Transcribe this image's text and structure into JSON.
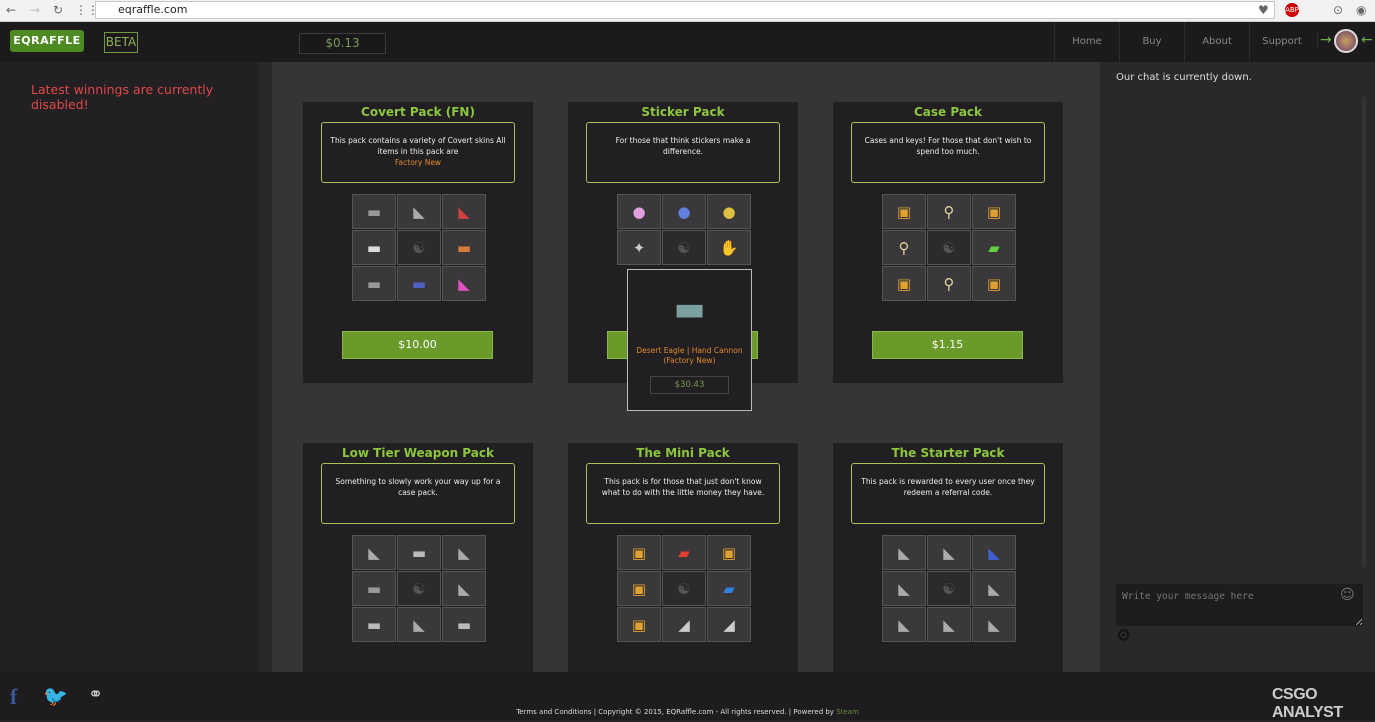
{
  "browser": {
    "url": "eqraffle.com"
  },
  "header": {
    "logo": "EQRAFFLE",
    "beta": "BETA",
    "balance": "$0.13",
    "nav": [
      "Home",
      "Buy",
      "About",
      "Support"
    ]
  },
  "left": {
    "message": "Latest winnings are currently disabled!"
  },
  "packs": [
    {
      "title": "Covert Pack (FN)",
      "desc": "This pack contains a variety of Covert skins All items in this pack are",
      "highlight": "Factory New",
      "price": "$10.00",
      "items": [
        "rifle",
        "pistol",
        "pistol-red",
        "rifle-white",
        "yinyang",
        "rifle-orange",
        "rifle",
        "smg-blue",
        "smg-pink"
      ]
    },
    {
      "title": "Sticker Pack",
      "desc": "For those that think stickers make a difference.",
      "highlight": "",
      "price": "",
      "items": [
        "sticker-pink",
        "sticker-blue",
        "sticker-yellow",
        "sticker-bird",
        "yinyang",
        "sticker-hand"
      ]
    },
    {
      "title": "Case Pack",
      "desc": "Cases and keys! For those that don't wish to spend too much.",
      "highlight": "",
      "price": "$1.15",
      "items": [
        "case",
        "key",
        "case",
        "key",
        "yinyang",
        "case-green",
        "case",
        "key",
        "case"
      ]
    },
    {
      "title": "Low Tier Weapon Pack",
      "desc": "Something to slowly work your way up for a case pack.",
      "highlight": "",
      "price": "",
      "items": [
        "pistol",
        "smg",
        "pistol",
        "rifle",
        "yinyang",
        "pistol",
        "smg",
        "pistol",
        "smg"
      ]
    },
    {
      "title": "The Mini Pack",
      "desc": "This pack is for those that just don't know what to do with the little money they have.",
      "highlight": "",
      "price": "",
      "items": [
        "case",
        "case-red",
        "case",
        "case",
        "yinyang",
        "case-blue",
        "case",
        "knife",
        "knife"
      ]
    },
    {
      "title": "The Starter Pack",
      "desc": "This pack is rewarded to every user once they redeem a referral code.",
      "highlight": "",
      "price": "",
      "items": [
        "pistol",
        "pistol",
        "pistol-blue",
        "pistol",
        "yinyang",
        "pistol",
        "pistol",
        "pistol",
        "pistol"
      ]
    }
  ],
  "tooltip": {
    "name": "Desert Eagle | Hand Cannon (Factory New)",
    "price": "$30.43"
  },
  "chat": {
    "status": "Our chat is currently down.",
    "placeholder": "Write your message here"
  },
  "footer": {
    "text": "Terms and Conditions | Copyright © 2015, EQRaffle.com - All rights reserved. | Powered by ",
    "steam": "Steam",
    "watermark": "CSGO ANALYST"
  },
  "colors": {
    "accent": "#8dc63f",
    "button": "#6a9a2a",
    "alert": "#e04848",
    "highlight": "#e08a30"
  }
}
